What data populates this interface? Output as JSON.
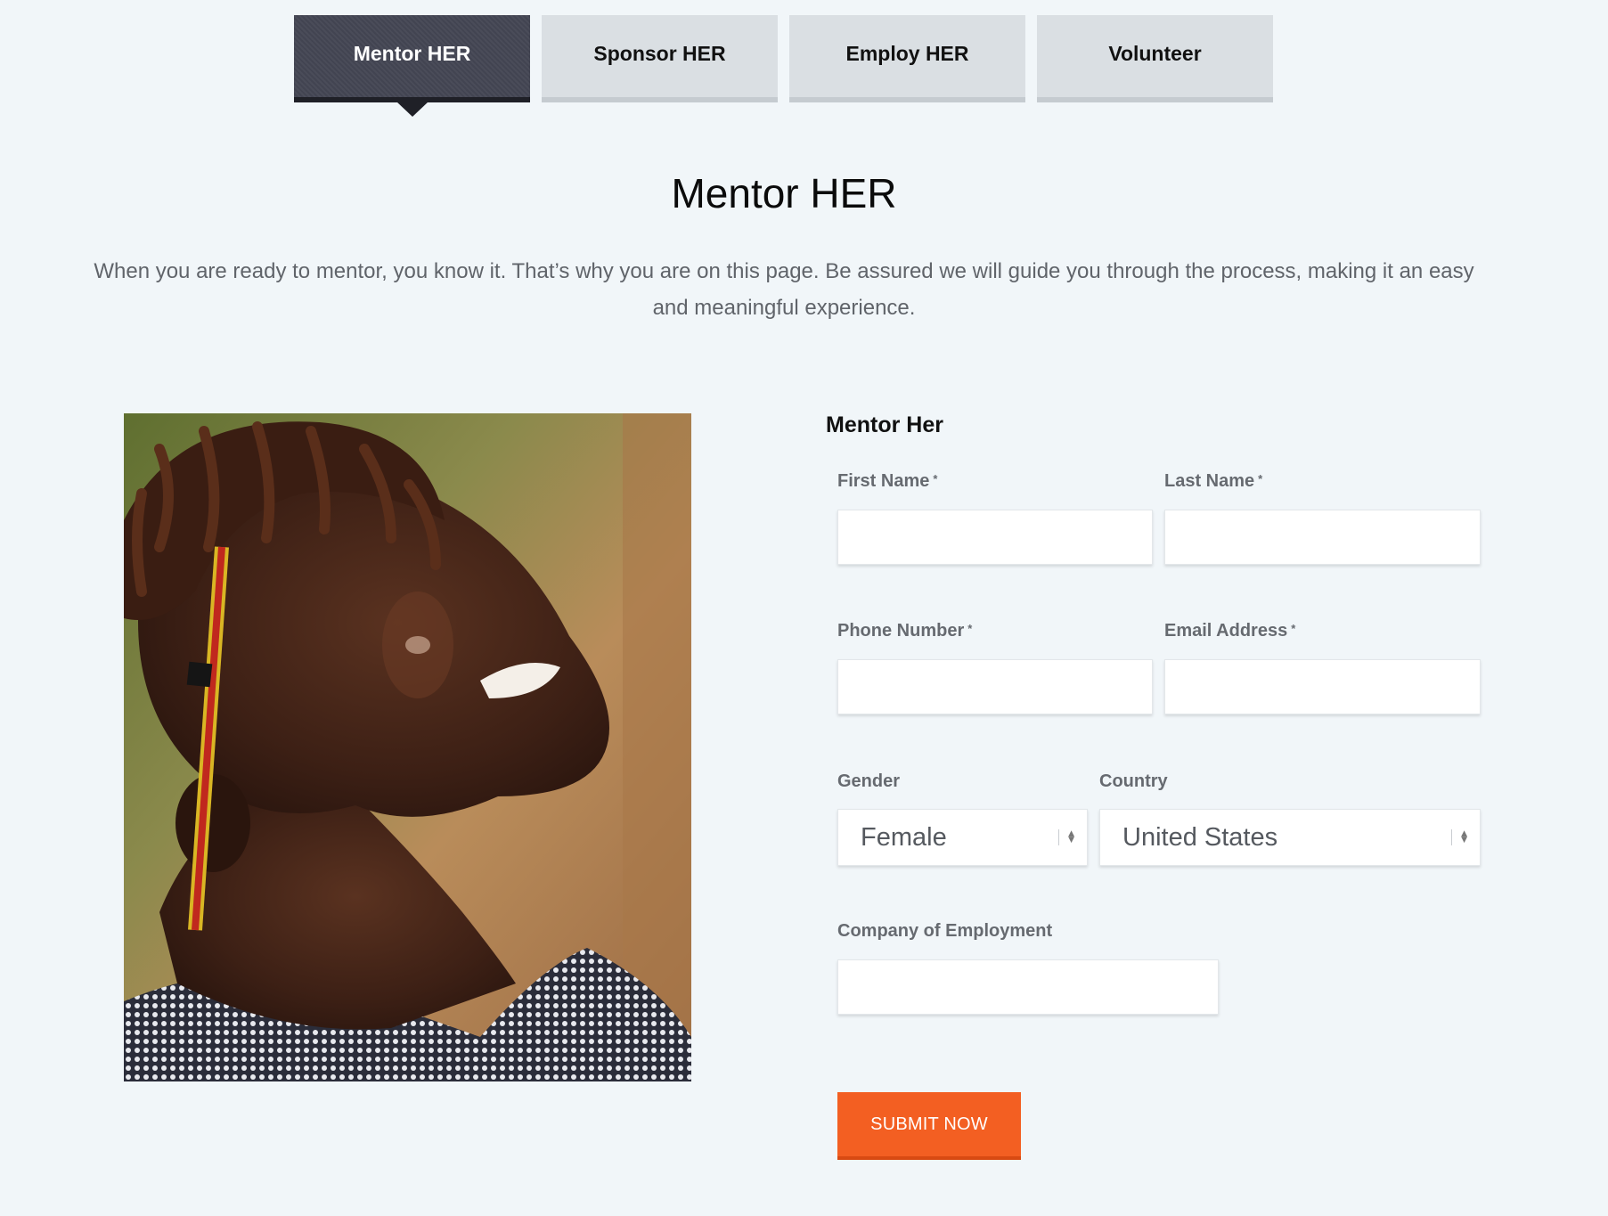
{
  "tabs": [
    {
      "label": "Mentor HER",
      "active": true
    },
    {
      "label": "Sponsor HER",
      "active": false
    },
    {
      "label": "Employ HER",
      "active": false
    },
    {
      "label": "Volunteer",
      "active": false
    }
  ],
  "page": {
    "title": "Mentor HER",
    "intro": "When you are ready to mentor, you know it. That’s why you are on this page. Be assured we will guide you through the process, making it an easy and meaningful experience."
  },
  "form": {
    "title": "Mentor Her",
    "required_mark": "*",
    "first_name_label": "First Name",
    "last_name_label": "Last Name",
    "phone_label": "Phone Number",
    "email_label": "Email Address",
    "gender_label": "Gender",
    "gender_value": "Female",
    "country_label": "Country",
    "country_value": "United States",
    "company_label": "Company of Employment",
    "first_name_value": "",
    "last_name_value": "",
    "phone_value": "",
    "email_value": "",
    "company_value": "",
    "submit_label": "SUBMIT NOW"
  },
  "colors": {
    "background": "#f1f6f9",
    "active_tab": "#444654",
    "inactive_tab": "#dadfe3",
    "submit": "#f35f22"
  }
}
